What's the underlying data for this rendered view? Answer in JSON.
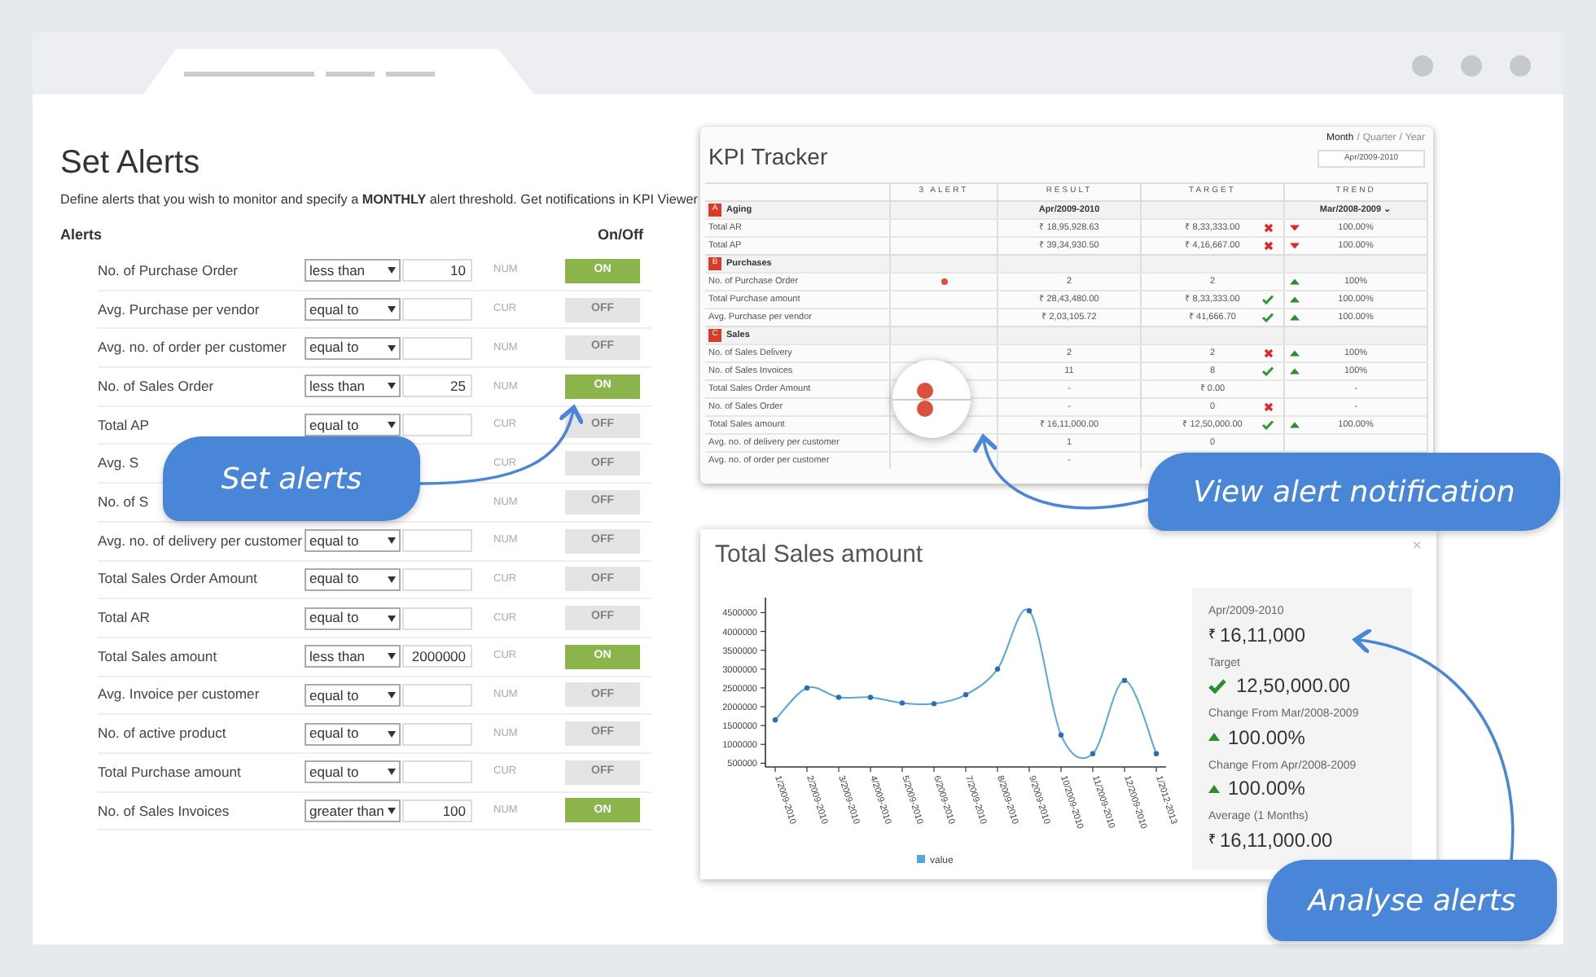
{
  "alerts": {
    "title": "Set Alerts",
    "description": "Define alerts that you wish to monitor and specify a **MONTHLY** alert threshold. Get notifications in KPI Viewer",
    "header_label": "Alerts",
    "header_toggle": "On/Off",
    "rows": [
      {
        "label": "No. of Purchase Order",
        "operator": "less than",
        "threshold": "10",
        "unit": "NUM",
        "toggle": "ON",
        "on": true
      },
      {
        "label": "Avg. Purchase per vendor",
        "operator": "equal to",
        "unit": "CUR",
        "toggle": "OFF",
        "on": false
      },
      {
        "label": "Avg. no. of order per customer",
        "operator": "equal to",
        "unit": "NUM",
        "toggle": "OFF",
        "on": false
      },
      {
        "label": "No. of Sales Order",
        "operator": "less than",
        "threshold": "25",
        "unit": "NUM",
        "toggle": "ON",
        "on": true
      },
      {
        "label": "Total AP",
        "operator": "equal to",
        "unit": "CUR",
        "toggle": "OFF",
        "on": false
      },
      {
        "label": "Avg. S",
        "unit": "CUR",
        "toggle": "OFF",
        "on": false
      },
      {
        "label": "No. of S",
        "unit": "NUM",
        "toggle": "OFF",
        "on": false
      },
      {
        "label": "Avg. no. of delivery per customer",
        "operator": "equal to",
        "unit": "NUM",
        "toggle": "OFF",
        "on": false
      },
      {
        "label": "Total Sales Order Amount",
        "operator": "equal to",
        "unit": "CUR",
        "toggle": "OFF",
        "on": false
      },
      {
        "label": "Total AR",
        "operator": "equal to",
        "unit": "CUR",
        "toggle": "OFF",
        "on": false
      },
      {
        "label": "Total Sales amount",
        "operator": "less than",
        "threshold": "2000000",
        "unit": "CUR",
        "toggle": "ON",
        "on": true
      },
      {
        "label": "Avg. Invoice per customer",
        "operator": "equal to",
        "unit": "NUM",
        "toggle": "OFF",
        "on": false
      },
      {
        "label": "No. of active product",
        "operator": "equal to",
        "unit": "NUM",
        "toggle": "OFF",
        "on": false
      },
      {
        "label": "Total Purchase amount",
        "operator": "equal to",
        "unit": "CUR",
        "toggle": "OFF",
        "on": false
      },
      {
        "label": "No. of Sales Invoices",
        "operator": "greater than",
        "threshold": "100",
        "unit": "NUM",
        "toggle": "ON",
        "on": true
      }
    ]
  },
  "kpi": {
    "title": "KPI Tracker",
    "periods": [
      {
        "label": "Month",
        "selected": true
      },
      {
        "label": "Quarter",
        "selected": false
      },
      {
        "label": "Year",
        "selected": false
      }
    ],
    "period_separators": [
      "/",
      "/"
    ],
    "period_dropdown": "Apr/2009-2010",
    "columns": [
      "3 ALERT",
      "RESULT",
      "TARGET",
      "TREND"
    ],
    "sections": [
      {
        "badge": "A",
        "name": "Aging",
        "result_header": "Apr/2009-2010",
        "trend_header": "Mar/2008-2009 ⌄",
        "rows": [
          {
            "label": "Total AR",
            "alert": false,
            "result": "₹ 18,95,928.63",
            "target": "₹ 8,33,333.00",
            "target_met": false,
            "trend_up": false,
            "change": "100.00%"
          },
          {
            "label": "Total AP",
            "alert": false,
            "result": "₹ 39,34,930.50",
            "target": "₹ 4,16,667.00",
            "target_met": false,
            "trend_up": false,
            "change": "100.00%"
          }
        ]
      },
      {
        "badge": "B",
        "name": "Purchases",
        "rows": [
          {
            "label": "No. of Purchase Order",
            "alert": true,
            "result": "2",
            "target": "2",
            "trend_up": true,
            "change": "100%"
          },
          {
            "label": "Total Purchase amount",
            "alert": false,
            "result": "₹ 28,43,480.00",
            "target": "₹ 8,33,333.00",
            "target_met": true,
            "trend_up": true,
            "change": "100.00%"
          },
          {
            "label": "Avg. Purchase per vendor",
            "alert": false,
            "result": "₹ 2,03,105.72",
            "target": "₹ 41,666.70",
            "target_met": true,
            "trend_up": true,
            "change": "100.00%"
          }
        ]
      },
      {
        "badge": "C",
        "name": "Sales",
        "rows": [
          {
            "label": "No. of Sales Delivery",
            "alert": false,
            "result": "2",
            "target": "2",
            "target_met": false,
            "trend_up": true,
            "change": "100%"
          },
          {
            "label": "No. of Sales Invoices",
            "alert": false,
            "result": "11",
            "target": "8",
            "target_met": true,
            "trend_up": true,
            "change": "100%"
          },
          {
            "label": "Total Sales Order Amount",
            "alert": true,
            "magnified": true,
            "result": "-",
            "target": "₹ 0.00",
            "change": "-"
          },
          {
            "label": "No. of Sales Order",
            "alert": true,
            "magnified": true,
            "result": "-",
            "target": "0",
            "target_met": false,
            "change": "-"
          },
          {
            "label": "Total Sales amount",
            "alert": false,
            "result": "₹ 16,11,000.00",
            "target": "₹ 12,50,000.00",
            "target_met": true,
            "trend_up": true,
            "change": "100.00%"
          },
          {
            "label": "Avg. no. of delivery per customer",
            "alert": false,
            "result": "1",
            "target": "0"
          },
          {
            "label": "Avg. no. of order per customer",
            "alert": false,
            "result": "-"
          }
        ]
      }
    ]
  },
  "detail": {
    "title": "Total Sales amount",
    "close": "×",
    "chart_data": {
      "type": "line",
      "x": [
        "1/2009-2010",
        "2/2009-2010",
        "3/2009-2010",
        "4/2009-2010",
        "5/2009-2010",
        "6/2009-2010",
        "7/2009-2010",
        "8/2009-2010",
        "9/2009-2010",
        "10/2009-2010",
        "11/2009-2010",
        "12/2009-2010",
        "1/2012-2013"
      ],
      "series": [
        {
          "name": "value",
          "color": "#5aa6dc",
          "marker": "circle",
          "values": [
            1650000,
            2500000,
            2250000,
            2250000,
            2100000,
            2080000,
            2320000,
            3000000,
            4550000,
            1250000,
            750000,
            2700000,
            750000
          ]
        }
      ],
      "ylim": [
        400000,
        4900000
      ],
      "yticks": [
        500000,
        1000000,
        1500000,
        2000000,
        2500000,
        3000000,
        3500000,
        4000000,
        4500000
      ]
    },
    "stats": [
      {
        "label": "Apr/2009-2010",
        "kind": "currency",
        "currency": "₹",
        "value": "16,11,000"
      },
      {
        "label": "Target",
        "kind": "check",
        "value": "12,50,000.00"
      },
      {
        "label": "Change From Mar/2008-2009",
        "kind": "up",
        "value": "100.00%"
      },
      {
        "label": "Change From Apr/2008-2009",
        "kind": "up",
        "value": "100.00%"
      },
      {
        "label": "Average (1 Months)",
        "kind": "currency",
        "currency": "₹",
        "value": "16,11,000.00"
      }
    ]
  },
  "callouts": [
    "Set alerts",
    "View alert notification",
    "Analyse alerts"
  ]
}
